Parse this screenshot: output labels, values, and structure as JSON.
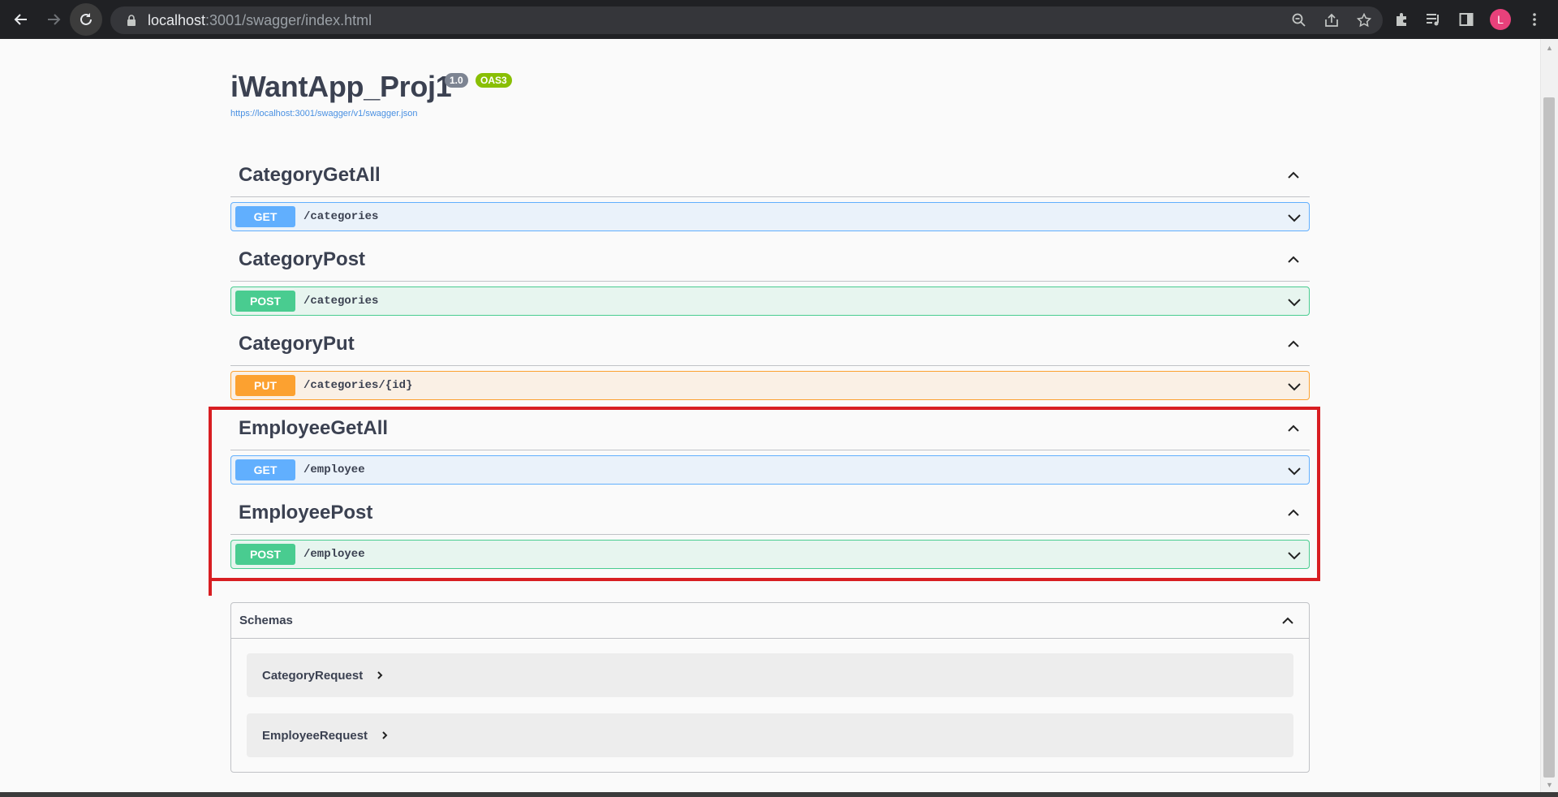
{
  "browser": {
    "url_host": "localhost",
    "url_rest": ":3001/swagger/index.html",
    "profile_initial": "L"
  },
  "info": {
    "title": "iWantApp_Proj1",
    "version": "1.0",
    "oas": "OAS3",
    "spec_url": "https://localhost:3001/swagger/v1/swagger.json"
  },
  "tags": [
    {
      "name": "CategoryGetAll",
      "method": "GET",
      "path": "/categories"
    },
    {
      "name": "CategoryPost",
      "method": "POST",
      "path": "/categories"
    },
    {
      "name": "CategoryPut",
      "method": "PUT",
      "path": "/categories/{id}"
    },
    {
      "name": "EmployeeGetAll",
      "method": "GET",
      "path": "/employee"
    },
    {
      "name": "EmployeePost",
      "method": "POST",
      "path": "/employee"
    }
  ],
  "schemas": {
    "title": "Schemas",
    "items": [
      "CategoryRequest",
      "EmployeeRequest"
    ]
  },
  "colors": {
    "get": "#61affe",
    "post": "#49cc90",
    "put": "#fca130",
    "highlight": "#d81e22"
  }
}
